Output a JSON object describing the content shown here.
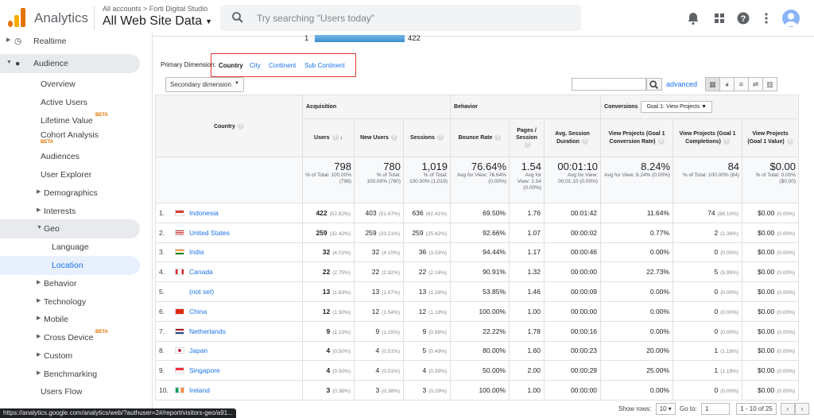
{
  "header": {
    "brand": "Analytics",
    "breadcrumb": "All accounts > Forti Digital Studio",
    "property": "All Web Site Data",
    "search_placeholder": "Try searching \"Users today\""
  },
  "sidebar": {
    "items": [
      {
        "label": "Realtime"
      },
      {
        "label": "Audience"
      },
      {
        "label": "Overview"
      },
      {
        "label": "Active Users"
      },
      {
        "label": "Lifetime Value",
        "badge": "BETA"
      },
      {
        "label": "Cohort Analysis",
        "badge": "BETA"
      },
      {
        "label": "Audiences"
      },
      {
        "label": "User Explorer"
      },
      {
        "label": "Demographics"
      },
      {
        "label": "Interests"
      },
      {
        "label": "Geo"
      },
      {
        "label": "Language"
      },
      {
        "label": "Location"
      },
      {
        "label": "Behavior"
      },
      {
        "label": "Technology"
      },
      {
        "label": "Mobile"
      },
      {
        "label": "Cross Device",
        "badge": "BETA"
      },
      {
        "label": "Custom"
      },
      {
        "label": "Benchmarking"
      },
      {
        "label": "Users Flow"
      }
    ],
    "status_url": "https://analytics.google.com/analytics/web/?authuser=2#/report/visitors-geo/a91..."
  },
  "top_chart": {
    "row_label": "1",
    "value": "422"
  },
  "primary_dimension": {
    "label": "Primary Dimension:",
    "options": [
      "Country",
      "City",
      "Continent",
      "Sub Continent"
    ]
  },
  "controls": {
    "secondary_dimension": "Secondary dimension",
    "advanced": "advanced"
  },
  "table": {
    "groups": {
      "acquisition": "Acquisition",
      "behavior": "Behavior",
      "conversions": "Conversions",
      "goal_select": "Goal 1: View Projects"
    },
    "headers": {
      "country": "Country",
      "users": "Users",
      "new_users": "New Users",
      "sessions": "Sessions",
      "bounce_rate": "Bounce Rate",
      "pages_session": "Pages / Session",
      "avg_session": "Avg. Session Duration",
      "conv_rate": "View Projects (Goal 1 Conversion Rate)",
      "completions": "View Projects (Goal 1 Completions)",
      "value": "View Projects (Goal 1 Value)"
    },
    "totals": {
      "users": {
        "v": "798",
        "s": "% of Total: 100.00% (798)"
      },
      "new_users": {
        "v": "780",
        "s": "% of Total: 100.00% (780)"
      },
      "sessions": {
        "v": "1,019",
        "s": "% of Total: 100.00% (1,019)"
      },
      "bounce_rate": {
        "v": "76.64%",
        "s": "Avg for View: 76.64% (0.00%)"
      },
      "pages_session": {
        "v": "1.54",
        "s": "Avg for View: 1.54 (0.00%)"
      },
      "avg_session": {
        "v": "00:01:10",
        "s": "Avg for View: 00:01:10 (0.00%)"
      },
      "conv_rate": {
        "v": "8.24%",
        "s": "Avg for View: 8.24% (0.00%)"
      },
      "completions": {
        "v": "84",
        "s": "% of Total: 100.00% (84)"
      },
      "value": {
        "v": "$0.00",
        "s": "% of Total: 0.00% ($0.00)"
      }
    },
    "rows": [
      {
        "idx": "1.",
        "country": "Indonesia",
        "flag": "id",
        "users": "422",
        "users_pct": "(52.82%)",
        "new_users": "403",
        "new_pct": "(51.67%)",
        "sessions": "636",
        "sess_pct": "(62.41%)",
        "bounce": "69.50%",
        "pages": "1.76",
        "dur": "00:01:42",
        "conv": "11.64%",
        "comp": "74",
        "comp_pct": "(88.10%)",
        "val": "$0.00",
        "val_pct": "(0.00%)"
      },
      {
        "idx": "2.",
        "country": "United States",
        "flag": "us",
        "users": "259",
        "users_pct": "(32.42%)",
        "new_users": "259",
        "new_pct": "(33.21%)",
        "sessions": "259",
        "sess_pct": "(25.42%)",
        "bounce": "92.66%",
        "pages": "1.07",
        "dur": "00:00:02",
        "conv": "0.77%",
        "comp": "2",
        "comp_pct": "(2.38%)",
        "val": "$0.00",
        "val_pct": "(0.00%)"
      },
      {
        "idx": "3.",
        "country": "India",
        "flag": "in",
        "users": "32",
        "users_pct": "(4.01%)",
        "new_users": "32",
        "new_pct": "(4.10%)",
        "sessions": "36",
        "sess_pct": "(3.53%)",
        "bounce": "94.44%",
        "pages": "1.17",
        "dur": "00:00:46",
        "conv": "0.00%",
        "comp": "0",
        "comp_pct": "(0.00%)",
        "val": "$0.00",
        "val_pct": "(0.00%)"
      },
      {
        "idx": "4.",
        "country": "Canada",
        "flag": "ca",
        "users": "22",
        "users_pct": "(2.75%)",
        "new_users": "22",
        "new_pct": "(2.82%)",
        "sessions": "22",
        "sess_pct": "(2.16%)",
        "bounce": "90.91%",
        "pages": "1.32",
        "dur": "00:00:00",
        "conv": "22.73%",
        "comp": "5",
        "comp_pct": "(5.95%)",
        "val": "$0.00",
        "val_pct": "(0.00%)"
      },
      {
        "idx": "5.",
        "country": "(not set)",
        "flag": "",
        "users": "13",
        "users_pct": "(1.63%)",
        "new_users": "13",
        "new_pct": "(1.67%)",
        "sessions": "13",
        "sess_pct": "(1.28%)",
        "bounce": "53.85%",
        "pages": "1.46",
        "dur": "00:00:09",
        "conv": "0.00%",
        "comp": "0",
        "comp_pct": "(0.00%)",
        "val": "$0.00",
        "val_pct": "(0.00%)"
      },
      {
        "idx": "6.",
        "country": "China",
        "flag": "cn",
        "users": "12",
        "users_pct": "(1.50%)",
        "new_users": "12",
        "new_pct": "(1.54%)",
        "sessions": "12",
        "sess_pct": "(1.18%)",
        "bounce": "100.00%",
        "pages": "1.00",
        "dur": "00:00:00",
        "conv": "0.00%",
        "comp": "0",
        "comp_pct": "(0.00%)",
        "val": "$0.00",
        "val_pct": "(0.00%)"
      },
      {
        "idx": "7.",
        "country": "Netherlands",
        "flag": "nl",
        "users": "9",
        "users_pct": "(1.13%)",
        "new_users": "9",
        "new_pct": "(1.15%)",
        "sessions": "9",
        "sess_pct": "(0.88%)",
        "bounce": "22.22%",
        "pages": "1.78",
        "dur": "00:00:16",
        "conv": "0.00%",
        "comp": "0",
        "comp_pct": "(0.00%)",
        "val": "$0.00",
        "val_pct": "(0.00%)"
      },
      {
        "idx": "8.",
        "country": "Japan",
        "flag": "jp",
        "users": "4",
        "users_pct": "(0.50%)",
        "new_users": "4",
        "new_pct": "(0.51%)",
        "sessions": "5",
        "sess_pct": "(0.49%)",
        "bounce": "80.00%",
        "pages": "1.60",
        "dur": "00:00:23",
        "conv": "20.00%",
        "comp": "1",
        "comp_pct": "(1.19%)",
        "val": "$0.00",
        "val_pct": "(0.00%)"
      },
      {
        "idx": "9.",
        "country": "Singapore",
        "flag": "sg",
        "users": "4",
        "users_pct": "(0.50%)",
        "new_users": "4",
        "new_pct": "(0.51%)",
        "sessions": "4",
        "sess_pct": "(0.39%)",
        "bounce": "50.00%",
        "pages": "2.00",
        "dur": "00:00:29",
        "conv": "25.00%",
        "comp": "1",
        "comp_pct": "(1.19%)",
        "val": "$0.00",
        "val_pct": "(0.00%)"
      },
      {
        "idx": "10.",
        "country": "Ireland",
        "flag": "ie",
        "users": "3",
        "users_pct": "(0.38%)",
        "new_users": "3",
        "new_pct": "(0.38%)",
        "sessions": "3",
        "sess_pct": "(0.29%)",
        "bounce": "100.00%",
        "pages": "1.00",
        "dur": "00:00:00",
        "conv": "0.00%",
        "comp": "0",
        "comp_pct": "(0.00%)",
        "val": "$0.00",
        "val_pct": "(0.00%)"
      }
    ]
  },
  "footer": {
    "show_rows_label": "Show rows:",
    "show_rows": "10",
    "goto_label": "Go to:",
    "goto": "1",
    "range": "1 - 10 of 25"
  }
}
